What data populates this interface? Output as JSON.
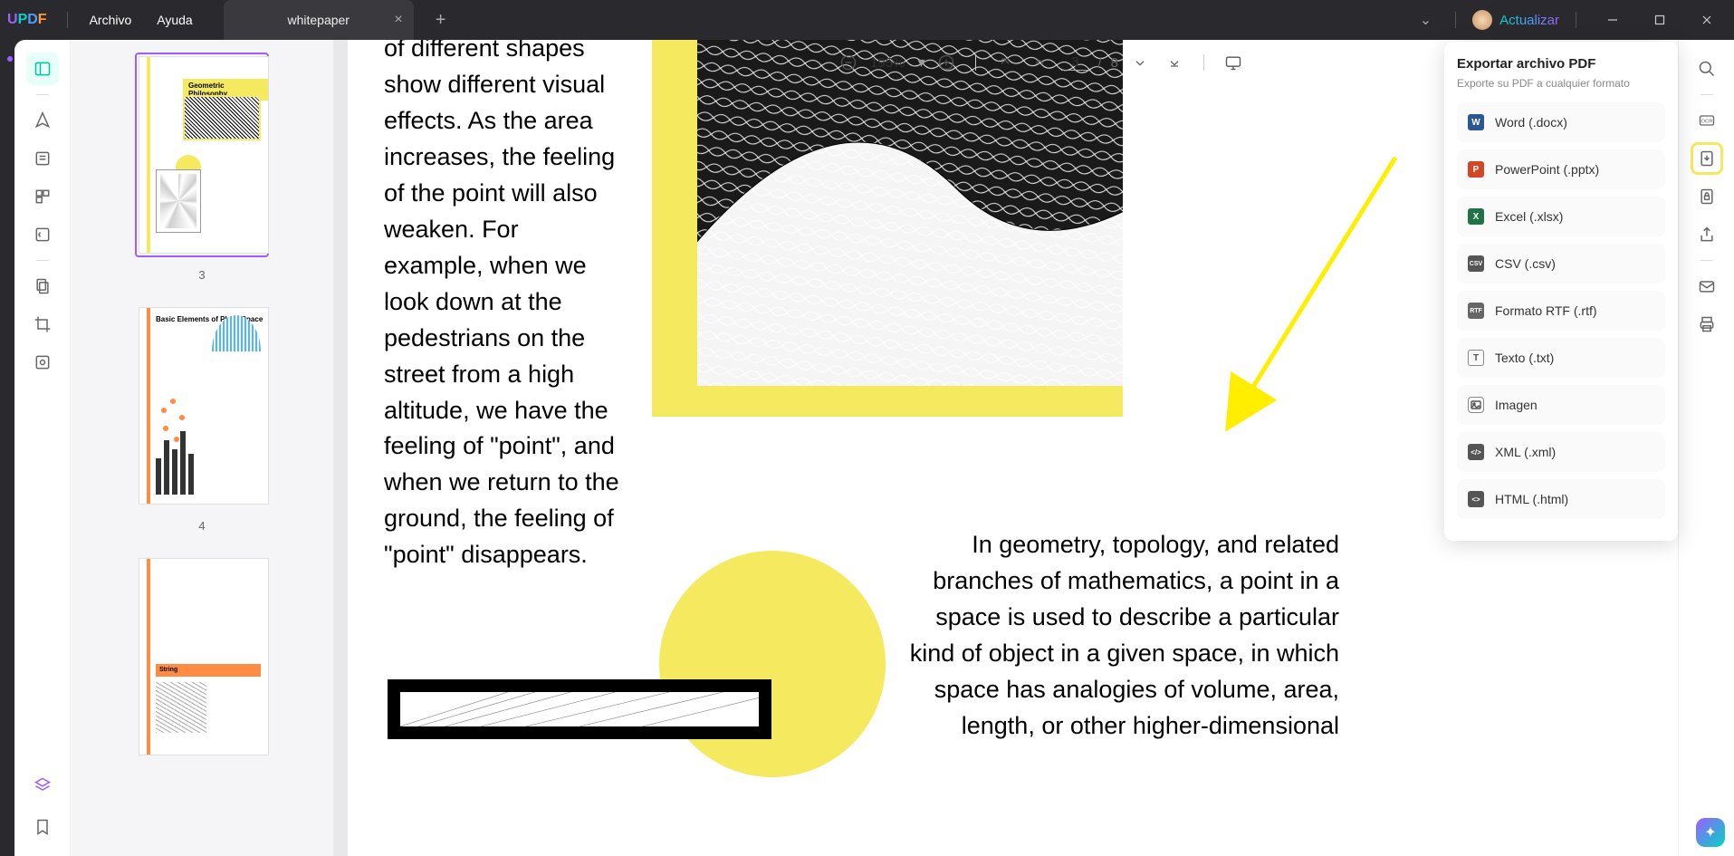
{
  "app": {
    "logo": "UPDF"
  },
  "menu": {
    "file": "Archivo",
    "help": "Ayuda"
  },
  "tab": {
    "title": "whitepaper"
  },
  "titleRight": {
    "upgrade": "Actualizar"
  },
  "toolbar": {
    "zoom": "195%",
    "pageCurrent": "3",
    "pageSep": "/",
    "pageTotal": "8"
  },
  "thumbs": {
    "t3": {
      "label": "3",
      "title": "Geometric Philosophy"
    },
    "t4": {
      "label": "4",
      "title": "Basic Elements of Plane Space"
    },
    "t5": {
      "label": "5",
      "string": "String"
    }
  },
  "page": {
    "text1": "of different shapes show different visual effects. As the area increases, the feeling of the point will also weaken. For example, when we look down at the pedestrians on the street from a high altitude, we have the feeling of \"point\", and when we return to the ground, the feeling of \"point\" disappears.",
    "text2": "In geometry, topology, and related branches of mathematics, a point in a space is used to describe a particular kind of object in a given space, in which space has analogies of volume, area, length, or other higher-dimensional"
  },
  "export": {
    "title": "Exportar archivo PDF",
    "subtitle": "Exporte su PDF a cualquier formato",
    "items": {
      "word": "Word (.docx)",
      "ppt": "PowerPoint (.pptx)",
      "xls": "Excel (.xlsx)",
      "csv": "CSV (.csv)",
      "rtf": "Formato RTF (.rtf)",
      "txt": "Texto (.txt)",
      "img": "Imagen",
      "xml": "XML (.xml)",
      "html": "HTML (.html)"
    }
  }
}
